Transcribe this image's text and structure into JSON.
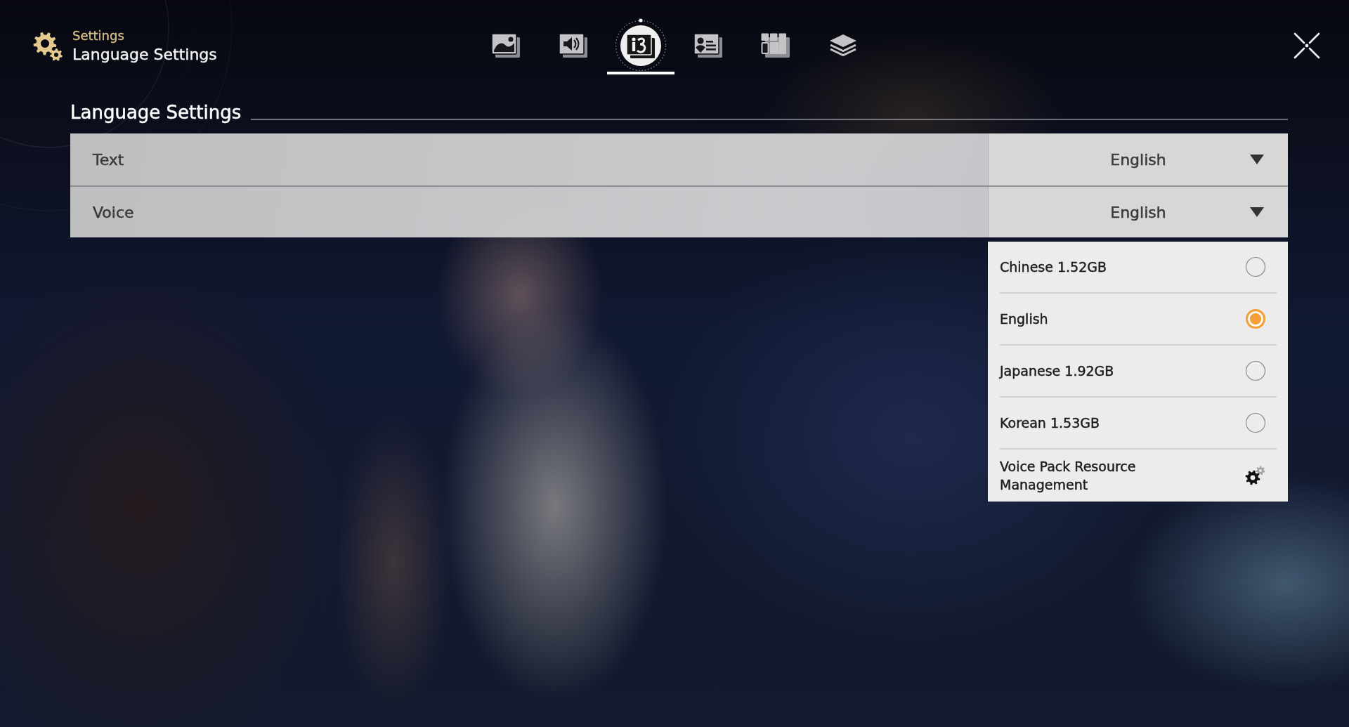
{
  "header": {
    "breadcrumb": "Settings",
    "title": "Language Settings"
  },
  "tabs": [
    {
      "kind": "picture",
      "selected": false
    },
    {
      "kind": "sound",
      "selected": false
    },
    {
      "kind": "language",
      "selected": true
    },
    {
      "kind": "profile",
      "selected": false
    },
    {
      "kind": "tiles",
      "selected": false
    },
    {
      "kind": "layers",
      "selected": false
    }
  ],
  "section": {
    "title": "Language Settings",
    "rows": [
      {
        "label": "Text",
        "value": "English"
      },
      {
        "label": "Voice",
        "value": "English",
        "options": [
          {
            "kind": "radio",
            "label": "Chinese 1.52GB",
            "selected": false
          },
          {
            "kind": "radio",
            "label": "English",
            "selected": true
          },
          {
            "kind": "radio",
            "label": "Japanese 1.92GB",
            "selected": false
          },
          {
            "kind": "radio",
            "label": "Korean 1.53GB",
            "selected": false
          },
          {
            "kind": "manage",
            "label": "Voice Pack Resource Management"
          }
        ]
      }
    ]
  }
}
